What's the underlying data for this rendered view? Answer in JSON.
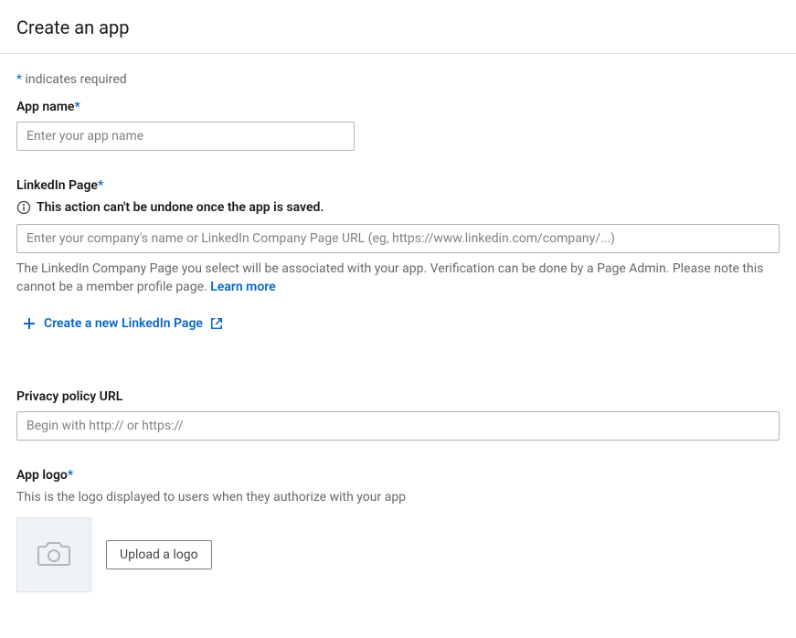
{
  "header": {
    "title": "Create an app"
  },
  "required_note": {
    "asterisk": "*",
    "text": " indicates required"
  },
  "app_name": {
    "label": "App name",
    "placeholder": "Enter your app name"
  },
  "linkedin_page": {
    "label": "LinkedIn Page",
    "warning": "This action can't be undone once the app is saved.",
    "placeholder": "Enter your company's name or LinkedIn Company Page URL (eg, https://www.linkedin.com/company/...)",
    "helper": "The LinkedIn Company Page you select will be associated with your app. Verification can be done by a Page Admin. Please note this cannot be a member profile page. ",
    "learn_more": "Learn more",
    "create_new": "Create a new LinkedIn Page"
  },
  "privacy_policy": {
    "label": "Privacy policy URL",
    "placeholder": "Begin with http:// or https://"
  },
  "app_logo": {
    "label": "App logo",
    "helper": "This is the logo displayed to users when they authorize with your app",
    "upload_btn": "Upload a logo"
  }
}
